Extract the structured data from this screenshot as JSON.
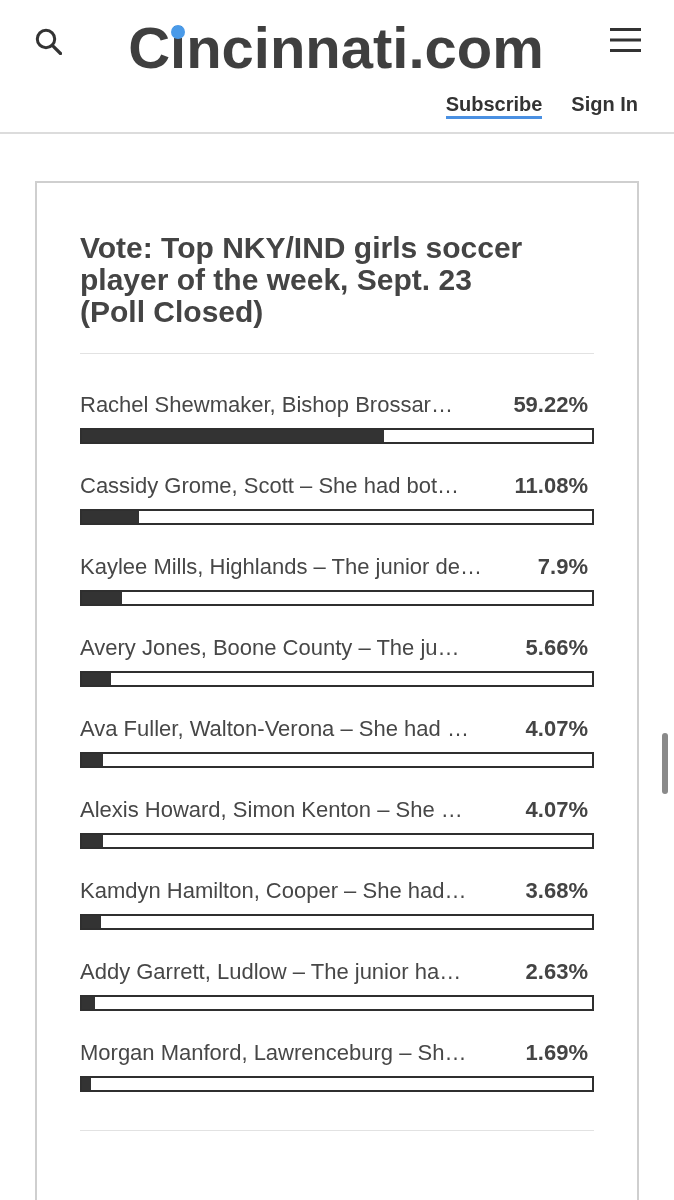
{
  "header": {
    "logo": "Cincinnati.com",
    "links": [
      {
        "label": "Subscribe",
        "highlighted": true
      },
      {
        "label": "Sign In",
        "highlighted": false
      }
    ]
  },
  "poll": {
    "title": "Vote: Top NKY/IND girls soccer player of the week, Sept. 23 (Poll Closed)",
    "options": [
      {
        "label": "Rachel Shewmaker, Bishop Brossar…",
        "percent": "59.22%",
        "level": 0.5922
      },
      {
        "label": "Cassidy Grome, Scott – She had bot…",
        "percent": "11.08%",
        "level": 0.1108
      },
      {
        "label": "Kaylee Mills, Highlands – The junior de…",
        "percent": "7.9%",
        "level": 0.079
      },
      {
        "label": "Avery Jones, Boone County – The ju…",
        "percent": "5.66%",
        "level": 0.0566
      },
      {
        "label": "Ava Fuller, Walton-Verona – She had …",
        "percent": "4.07%",
        "level": 0.0407
      },
      {
        "label": "Alexis Howard, Simon Kenton – She …",
        "percent": "4.07%",
        "level": 0.0407
      },
      {
        "label": "Kamdyn Hamilton, Cooper – She had…",
        "percent": "3.68%",
        "level": 0.0368
      },
      {
        "label": "Addy Garrett, Ludlow – The junior ha…",
        "percent": "2.63%",
        "level": 0.0263
      },
      {
        "label": "Morgan Manford, Lawrenceburg – Sh…",
        "percent": "1.69%",
        "level": 0.0169
      }
    ]
  }
}
